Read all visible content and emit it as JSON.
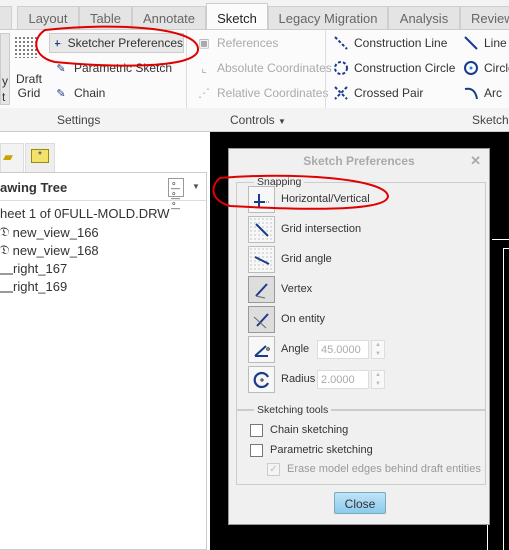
{
  "tabs": [
    {
      "label": "Layout"
    },
    {
      "label": "Table"
    },
    {
      "label": "Annotate"
    },
    {
      "label": "Sketch",
      "active": true
    },
    {
      "label": "Legacy Migration"
    },
    {
      "label": "Analysis"
    },
    {
      "label": "Review"
    }
  ],
  "ribbon": {
    "settings": {
      "draft_grid_line1": "Draft",
      "draft_grid_line2": "Grid",
      "left_clip": "y",
      "left_clip2": "t",
      "sketcher_preferences": "Sketcher Preferences",
      "parametric_sketch": "Parametric Sketch",
      "chain": "Chain",
      "group_label": "Settings"
    },
    "controls": {
      "references": "References",
      "absolute_coordinates": "Absolute Coordinates",
      "relative_coordinates": "Relative Coordinates",
      "group_label": "Controls"
    },
    "sketching": {
      "construction_line": "Construction Line",
      "construction_circle": "Construction Circle",
      "crossed_pair": "Crossed Pair",
      "line": "Line",
      "circle": "Circle",
      "arc": "Arc",
      "group_label": "Sketchi"
    }
  },
  "tree": {
    "title": "awing Tree",
    "root": "heet 1 of 0FULL-MOLD.DRW",
    "items": [
      "new_view_166",
      "new_view_168",
      "right_167",
      "right_169"
    ]
  },
  "dialog": {
    "title": "Sketch Preferences",
    "snapping_label": "Snapping",
    "snapping": [
      {
        "label": "Horizontal/Vertical",
        "on": false
      },
      {
        "label": "Grid intersection",
        "on": false
      },
      {
        "label": "Grid angle",
        "on": false
      },
      {
        "label": "Vertex",
        "on": true
      },
      {
        "label": "On entity",
        "on": true
      },
      {
        "label": "Angle",
        "on": false
      },
      {
        "label": "Radius",
        "on": false
      }
    ],
    "angle_value": "45.0000",
    "radius_value": "2.0000",
    "tools_label": "Sketching tools",
    "chain_sketching": "Chain sketching",
    "parametric_sketching": "Parametric sketching",
    "erase_edges": "Erase model edges behind draft entities",
    "close": "Close"
  },
  "colors": {
    "annotation": "#e00000",
    "icon_blue": "#1a3a8a",
    "canvas": "#000000"
  }
}
